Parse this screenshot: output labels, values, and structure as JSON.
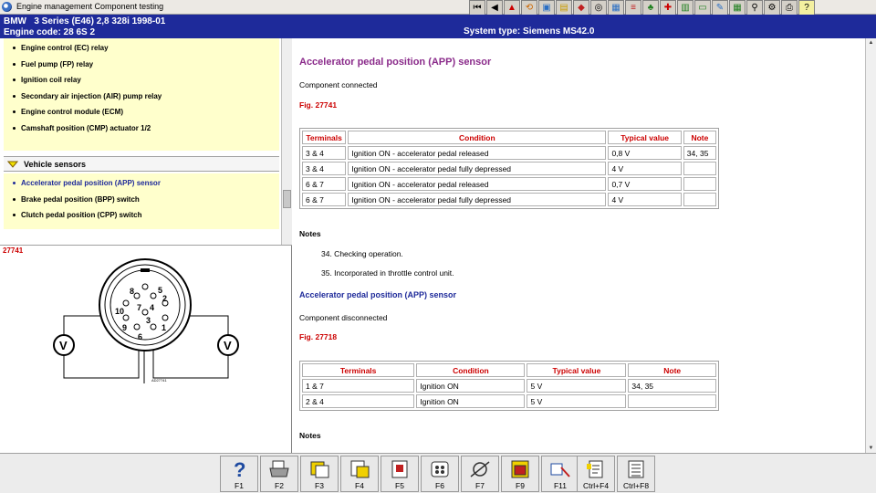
{
  "window": {
    "title": "Engine management Component testing",
    "icon": "app-globe-icon"
  },
  "toolbar": {
    "icons": [
      "first-page-icon",
      "prev-icon",
      "warning-icon",
      "reset-icon",
      "image-icon",
      "folder-icon",
      "car-icon",
      "wheel-icon",
      "chart-icon",
      "document-icon",
      "tree-icon",
      "info-icon",
      "book-icon",
      "ticket-icon",
      "tool-icon",
      "table-icon",
      "search-icon",
      "settings-icon",
      "print-icon",
      "help-icon"
    ]
  },
  "header": {
    "vehicle": "BMW   3 Series (E46) 2,8 328i 1998-01",
    "engine_code": "Engine code: 28 6S 2",
    "system_type": "System type: Siemens MS42.0"
  },
  "sidebar": {
    "items_top": [
      "Engine control (EC) relay",
      "Fuel pump (FP) relay",
      "Ignition coil relay",
      "Secondary air injection (AIR) pump relay",
      "Engine control module (ECM)",
      "Camshaft position (CMP) actuator 1/2"
    ],
    "category": "Vehicle sensors",
    "items_sensors": [
      "Accelerator pedal position (APP) sensor",
      "Brake pedal position (BPP) switch",
      "Clutch pedal position (CPP) switch"
    ],
    "figure_label": "27741",
    "diagram": {
      "pins": [
        "1",
        "2",
        "3",
        "4",
        "5",
        "6",
        "7",
        "8",
        "9",
        "10"
      ],
      "meter_symbol": "V",
      "ref": "AD27741"
    }
  },
  "content": {
    "title": "Accelerator pedal position (APP) sensor",
    "section1": {
      "status": "Component connected",
      "fig": "Fig. 27741",
      "headers": [
        "Terminals",
        "Condition",
        "Typical value",
        "Note"
      ],
      "rows": [
        [
          "3 & 4",
          "Ignition ON - accelerator pedal released",
          "0,8 V",
          "34, 35"
        ],
        [
          "3 & 4",
          "Ignition ON - accelerator pedal fully depressed",
          "4 V",
          ""
        ],
        [
          "6 & 7",
          "Ignition ON - accelerator pedal released",
          "0,7 V",
          ""
        ],
        [
          "6 & 7",
          "Ignition ON - accelerator pedal fully depressed",
          "4 V",
          ""
        ]
      ],
      "notes_title": "Notes",
      "notes": [
        "34. Checking operation.",
        "35. Incorporated in throttle control unit."
      ]
    },
    "section2": {
      "title": "Accelerator pedal position (APP) sensor",
      "status": "Component disconnected",
      "fig": "Fig. 27718",
      "headers": [
        "Terminals",
        "Condition",
        "Typical value",
        "Note"
      ],
      "rows": [
        [
          "1 & 7",
          "Ignition ON",
          "5 V",
          "34, 35"
        ],
        [
          "2 & 4",
          "Ignition ON",
          "5 V",
          ""
        ]
      ],
      "notes_title": "Notes"
    }
  },
  "function_keys": [
    {
      "label": "F1",
      "icon": "help-icon"
    },
    {
      "label": "F2",
      "icon": "print-icon"
    },
    {
      "label": "F3",
      "icon": "copy-icon"
    },
    {
      "label": "F4",
      "icon": "paste-icon"
    },
    {
      "label": "F5",
      "icon": "component-icon"
    },
    {
      "label": "F6",
      "icon": "connector-icon"
    },
    {
      "label": "F7",
      "icon": "test-icon"
    },
    {
      "label": "F9",
      "icon": "diagram-icon"
    },
    {
      "label": "F11",
      "icon": "probe-icon"
    },
    {
      "label": "Ctrl+F4",
      "icon": "note-icon"
    },
    {
      "label": "Ctrl+F8",
      "icon": "list-icon"
    }
  ],
  "colors": {
    "header_bg": "#1e2a9a",
    "title_purple": "#8a2a8a",
    "fig_red": "#cc0000",
    "list_bg": "#ffffcc"
  }
}
